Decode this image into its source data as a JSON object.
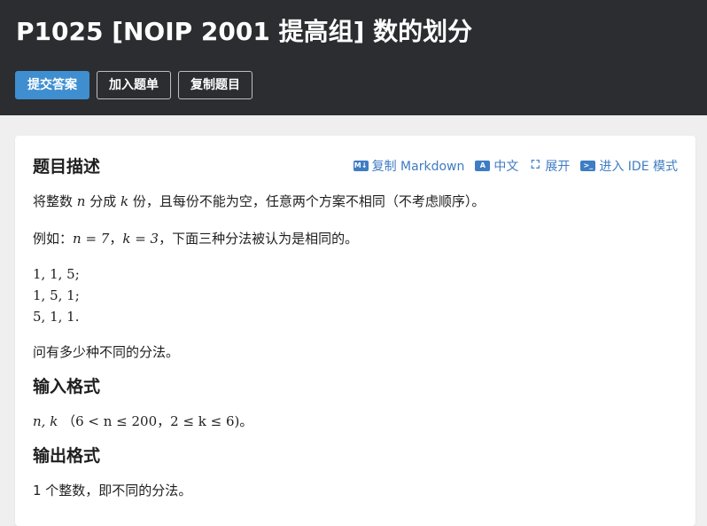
{
  "header": {
    "title": "P1025 [NOIP 2001 提高组] 数的划分",
    "buttons": {
      "submit": "提交答案",
      "add_list": "加入题单",
      "copy": "复制题目"
    }
  },
  "card": {
    "heading": "题目描述",
    "actions": {
      "copy_md": "复制 Markdown",
      "lang": "中文",
      "expand": "展开",
      "ide": "进入 IDE 模式"
    },
    "desc_pre": "将整数",
    "desc_n": "n",
    "desc_mid": "分成",
    "desc_k": "k",
    "desc_post": "份，且每份不能为空，任意两个方案不相同（不考虑顺序）。",
    "example_pre": "例如：",
    "example_expr1": "n = 7",
    "example_sep": "，",
    "example_expr2": "k = 3",
    "example_post": "，下面三种分法被认为是相同的。",
    "cases": [
      "1, 1, 5;",
      "1, 5, 1;",
      "5, 1, 1."
    ],
    "question": "问有多少种不同的分法。",
    "input_heading": "输入格式",
    "input_vars": "n, k",
    "input_range1": "（6 < n ≤ 200",
    "input_comma": "，",
    "input_range2": "2 ≤ k ≤ 6)",
    "input_period": "。",
    "output_heading": "输出格式",
    "output_line": "1 个整数，即不同的分法。"
  },
  "icons": [
    "markdown-icon",
    "translate-icon",
    "expand-icon",
    "terminal-icon"
  ],
  "colors": {
    "header_bg": "#2b2d30",
    "primary": "#3e8ed0",
    "link": "#3e7cc4"
  }
}
